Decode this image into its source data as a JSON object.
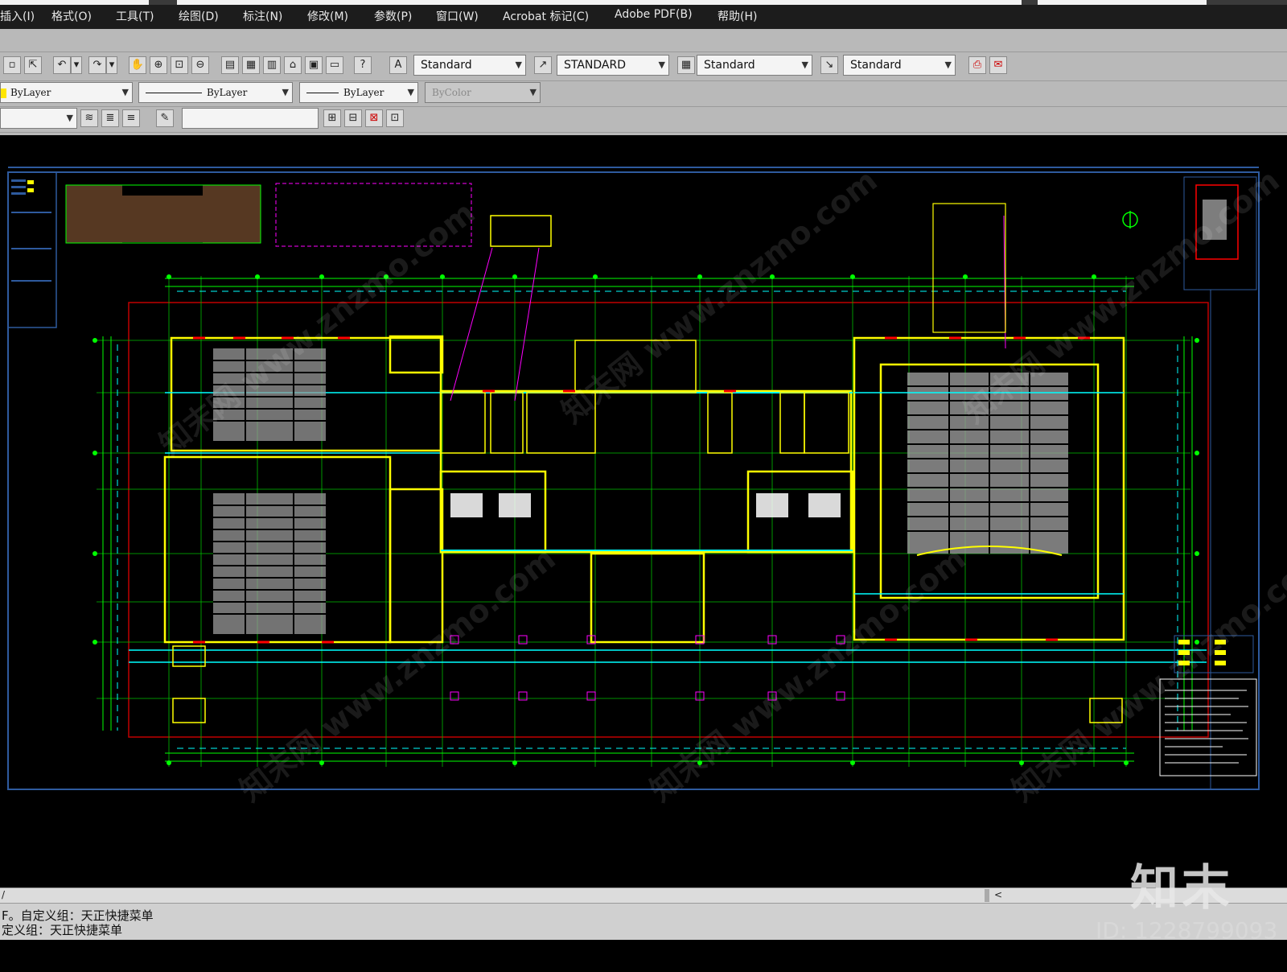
{
  "menu": {
    "items": [
      "插入(I)",
      "格式(O)",
      "工具(T)",
      "绘图(D)",
      "标注(N)",
      "修改(M)",
      "参数(P)",
      "窗口(W)",
      "Acrobat 标记(C)",
      "Adobe PDF(B)",
      "帮助(H)"
    ]
  },
  "toolbar": {
    "text_style": "Standard",
    "dim_style": "STANDARD",
    "table_style": "Standard",
    "multileader_style": "Standard",
    "layer_color": "ByLayer",
    "linetype": "ByLayer",
    "lineweight": "ByLayer",
    "plot_style": "ByColor"
  },
  "statusbar": {
    "tab_marker": "/",
    "scroll_left": "<"
  },
  "command": {
    "line1": "F。自定义组：天正快捷菜单",
    "line2": "定义组：天正快捷菜单"
  },
  "overlay": {
    "brand": "知末",
    "image_id": "ID: 1228799093",
    "watermark": "知末网 www.znzmo.com"
  },
  "colors": {
    "cad_green": "#00ff00",
    "cad_yellow": "#ffff00",
    "cad_cyan": "#00ffff",
    "cad_red": "#ff0000",
    "cad_magenta": "#ff00ff",
    "frame_blue": "#2e5a9e"
  }
}
